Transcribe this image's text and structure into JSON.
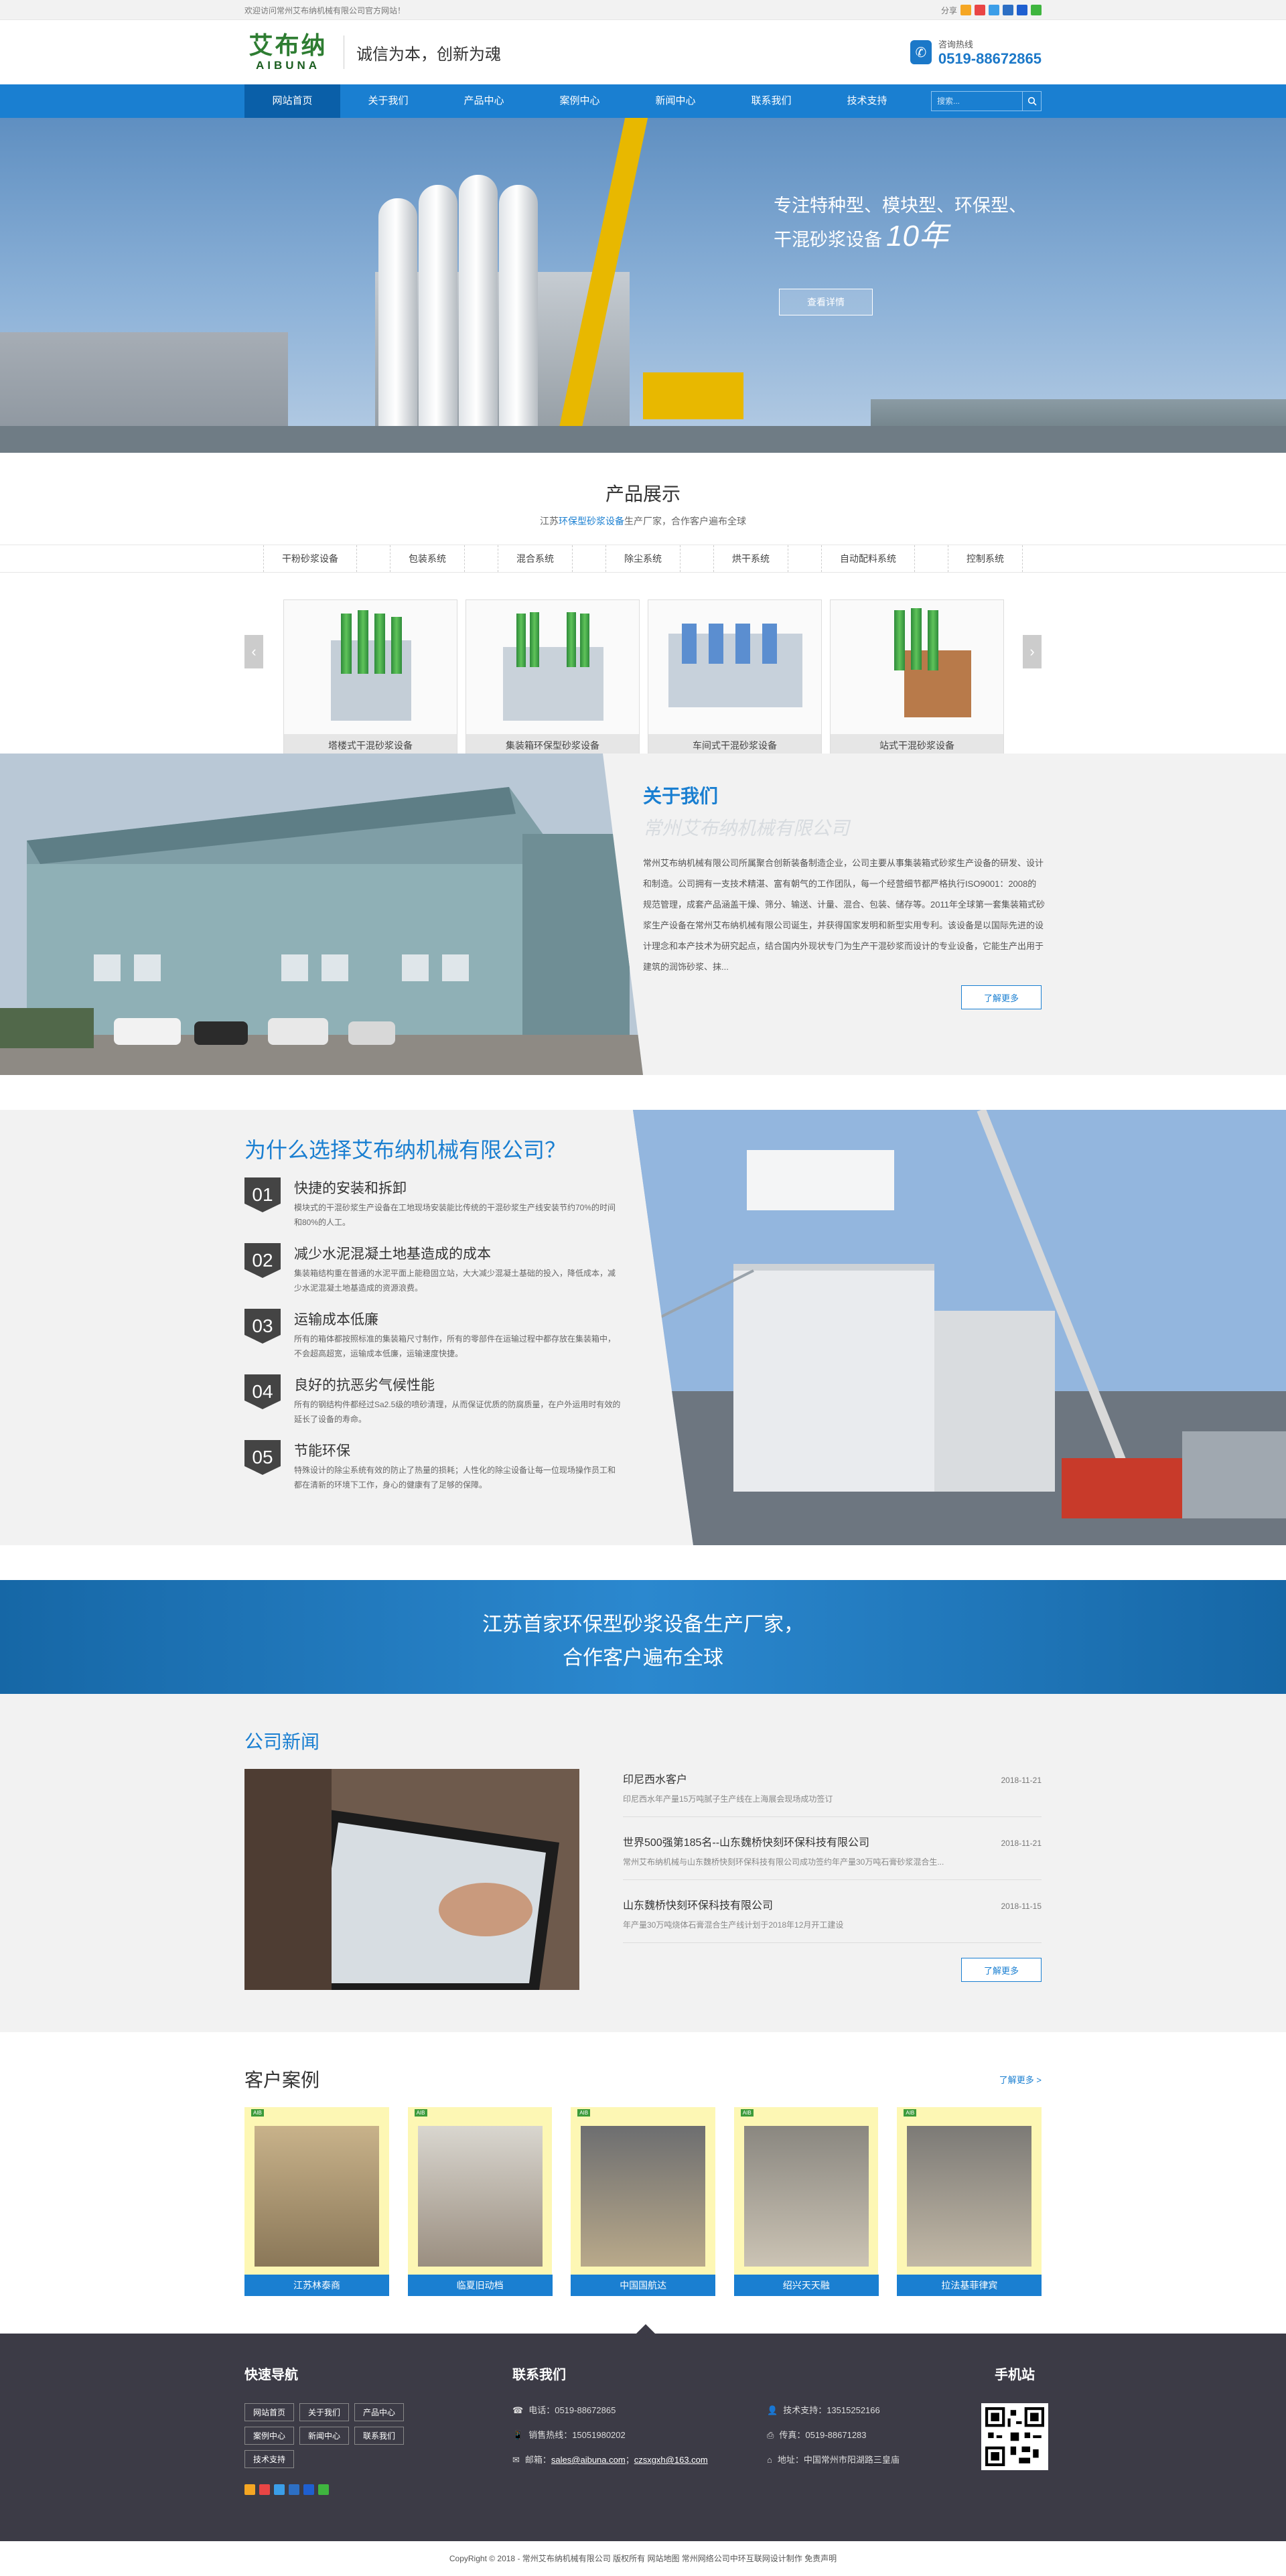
{
  "topbar": {
    "welcome": "欢迎访问常州艾布纳机械有限公司官方网站！",
    "share_label": "分享",
    "social_icons": [
      "qzone-icon",
      "sina-weibo-icon",
      "tencent-weibo-icon",
      "renren-icon",
      "baidu-icon",
      "wechat-icon"
    ]
  },
  "header": {
    "logo_cn": "艾布纳",
    "logo_en": "AIBUNA",
    "slogan": "诚信为本，创新为魂",
    "hotline_label": "咨询热线",
    "hotline": "0519-88672865"
  },
  "nav": {
    "items": [
      "网站首页",
      "关于我们",
      "产品中心",
      "案例中心",
      "新闻中心",
      "联系我们",
      "技术支持"
    ],
    "active_index": 0,
    "search_placeholder": "搜索..."
  },
  "banner": {
    "line1": "专注特种型、模块型、环保型、",
    "line2": "干混砂浆设备",
    "years": "10年",
    "button": "查看详情"
  },
  "products": {
    "title": "产品展示",
    "subtitle_pre": "江苏",
    "subtitle_hl": "环保型砂浆设备",
    "subtitle_post": "生产厂家，合作客户遍布全球",
    "tabs": [
      "干粉砂浆设备",
      "包装系统",
      "混合系统",
      "除尘系统",
      "烘干系统",
      "自动配料系统",
      "控制系统"
    ],
    "items": [
      "塔楼式干混砂浆设备",
      "集装箱环保型砂浆设备",
      "车间式干混砂浆设备",
      "站式干混砂浆设备"
    ]
  },
  "about": {
    "title": "关于我们",
    "subtitle": "常州艾布纳机械有限公司",
    "text": "常州艾布纳机械有限公司所属聚合创新装备制造企业，公司主要从事集装箱式砂浆生产设备的研发、设计和制造。公司拥有一支技术精湛、富有朝气的工作团队，每一个经营细节都严格执行ISO9001：2008的规范管理，成套产品涵盖干燥、筛分、输送、计量、混合、包装、储存等。2011年全球第一套集装箱式砂浆生产设备在常州艾布纳机械有限公司诞生，并获得国家发明和新型实用专利。该设备是以国际先进的设计理念和本产技术为研究起点，结合国内外现状专门为生产干混砂浆而设计的专业设备，它能生产出用于建筑的润饰砂浆、抹...",
    "more": "了解更多"
  },
  "why": {
    "title": "为什么选择艾布纳机械有限公司？",
    "items": [
      {
        "num": "01",
        "title": "快捷的安装和拆卸",
        "text": "模块式的干混砂浆生产设备在工地现场安装能比传统的干混砂浆生产线安装节约70%的时间和80%的人工。"
      },
      {
        "num": "02",
        "title": "减少水泥混凝土地基造成的成本",
        "text": "集装箱结构重在普通的水泥平面上能稳固立站，大大减少混凝土基础的投入，降低成本，减少水泥混凝土地基造成的资源浪费。"
      },
      {
        "num": "03",
        "title": "运输成本低廉",
        "text": "所有的箱体都按照标准的集装箱尺寸制作，所有的零部件在运输过程中都存放在集装箱中，不会超高超宽，运输成本低廉，运输速度快捷。"
      },
      {
        "num": "04",
        "title": "良好的抗恶劣气候性能",
        "text": "所有的钢结构件都经过Sa2.5级的喷砂清理，从而保证优质的防腐质量，在户外运用时有效的延长了设备的寿命。"
      },
      {
        "num": "05",
        "title": "节能环保",
        "text": "特殊设计的除尘系统有效的防止了热量的损耗；人性化的除尘设备让每一位现场操作员工和都在清新的环境下工作，身心的健康有了足够的保障。"
      }
    ]
  },
  "band": {
    "line1": "江苏首家环保型砂浆设备生产厂家，",
    "line2": "合作客户遍布全球"
  },
  "news": {
    "title": "公司新闻",
    "items": [
      {
        "title": "印尼西水客户",
        "date": "2018-11-21",
        "summary": "印尼西水年产量15万吨腻子生产线在上海展会现场成功签订"
      },
      {
        "title": "世界500强第185名--山东魏桥快刻环保科技有限公司",
        "date": "2018-11-21",
        "summary": "常州艾布纳机械与山东魏桥快刻环保科技有限公司成功签约年产量30万吨石膏砂浆混合生..."
      },
      {
        "title": "山东魏桥快刻环保科技有限公司",
        "date": "2018-11-15",
        "summary": "年产量30万吨烧体石膏混合生产线计划于2018年12月开工建设"
      }
    ],
    "more": "了解更多"
  },
  "cases": {
    "title": "客户案例",
    "more": "了解更多 >",
    "items": [
      "江苏林泰商",
      "临夏旧动档",
      "中国国航达",
      "绍兴天天融",
      "拉法基菲律宾"
    ]
  },
  "footer": {
    "nav_title": "快速导航",
    "links": [
      "网站首页",
      "关于我们",
      "产品中心",
      "案例中心",
      "新闻中心",
      "联系我们",
      "技术支持"
    ],
    "contact_title": "联系我们",
    "phone_label": "电话：",
    "phone": "0519-88672865",
    "tech_label": "技术支持：",
    "tech": "13515252166",
    "sales_label": "销售热线：",
    "sales": "15051980202",
    "fax_label": "传真：",
    "fax": "0519-88671283",
    "email_label": "邮箱：",
    "email1": "sales@aibuna.com",
    "email_sep": "；",
    "email2": "czsxgxh@163.com",
    "addr_label": "地址：",
    "addr": "中国常州市阳湖路三皇庙",
    "mobile_title": "手机站",
    "copyright": "CopyRight © 2018 - 常州艾布纳机械有限公司 版权所有   网站地图   常州网络公司中环互联网设计制作   免责声明"
  },
  "colors": {
    "primary": "#1a7fd1",
    "nav_active": "#0a5fa8",
    "footer": "#3c3b46",
    "case_bg": "#fdf7b4"
  }
}
